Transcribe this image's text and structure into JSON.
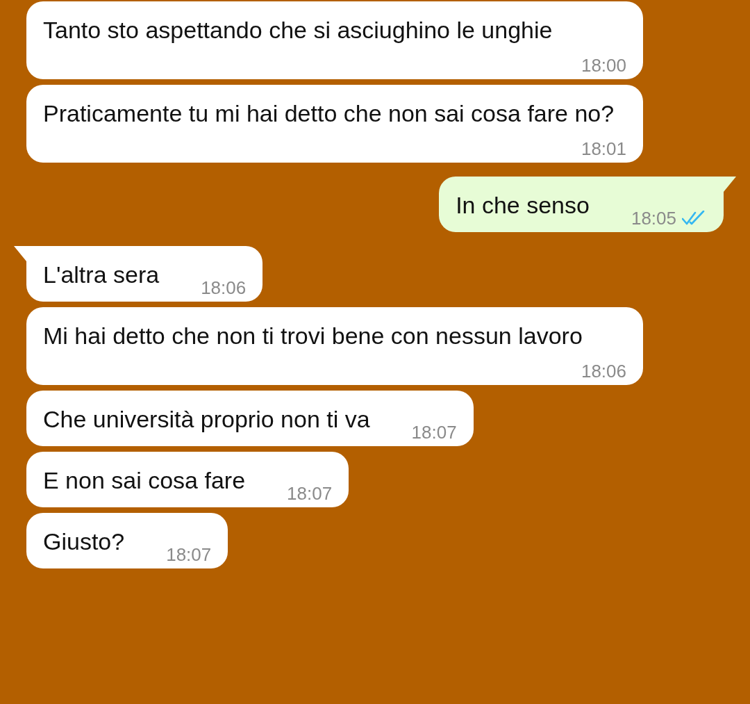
{
  "messages": [
    {
      "kind": "incoming",
      "tail": false,
      "text": "Tanto sto aspettando che si asciughino le unghie",
      "time": "18:00"
    },
    {
      "kind": "incoming",
      "tail": false,
      "text": "Praticamente tu mi hai detto che non sai cosa fare no?",
      "time": "18:01"
    },
    {
      "kind": "outgoing",
      "tail": true,
      "text": "In che senso",
      "time": "18:05",
      "read": true
    },
    {
      "kind": "incoming",
      "tail": true,
      "text": "L'altra sera",
      "time": "18:06"
    },
    {
      "kind": "incoming",
      "tail": false,
      "text": "Mi hai detto che non ti trovi bene con nessun lavoro",
      "time": "18:06"
    },
    {
      "kind": "incoming",
      "tail": false,
      "text": "Che università proprio non ti va",
      "time": "18:07"
    },
    {
      "kind": "incoming",
      "tail": false,
      "text": "E non sai cosa fare",
      "time": "18:07"
    },
    {
      "kind": "incoming",
      "tail": false,
      "text": "Giusto?",
      "time": "18:07"
    }
  ]
}
